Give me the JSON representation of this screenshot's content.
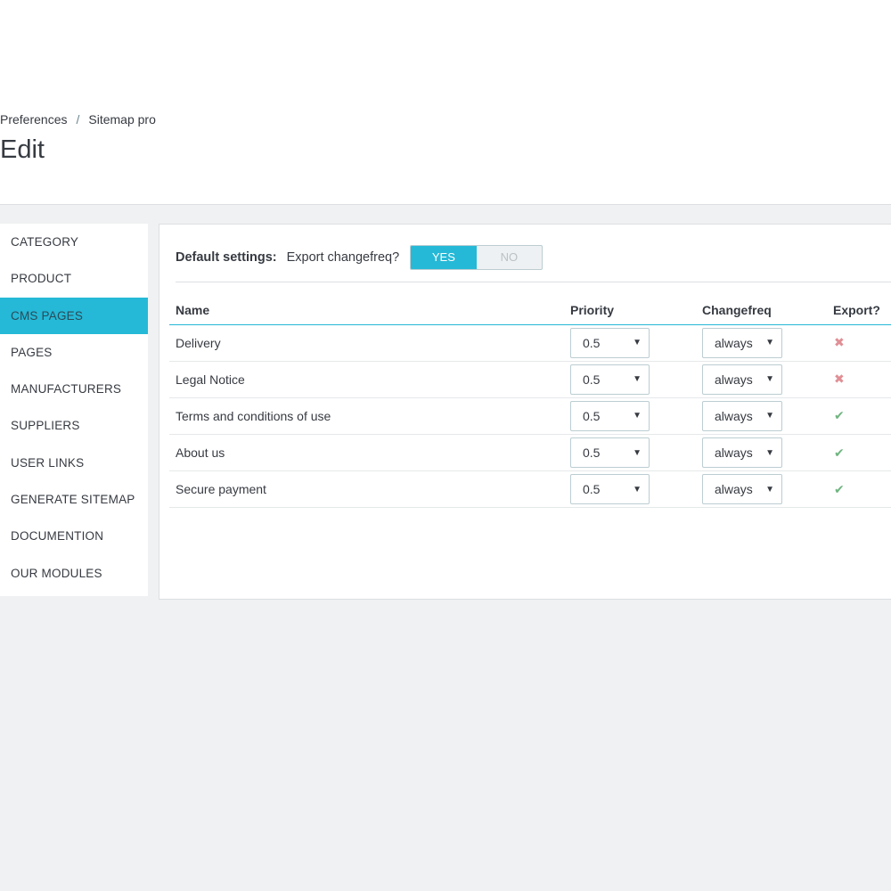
{
  "breadcrumb": {
    "parent": "Preferences",
    "separator": "/",
    "current": "Sitemap pro"
  },
  "page_title": "Edit",
  "sidebar": {
    "items": [
      {
        "label": "CATEGORY"
      },
      {
        "label": "PRODUCT"
      },
      {
        "label": "CMS PAGES",
        "active": true
      },
      {
        "label": "PAGES"
      },
      {
        "label": "MANUFACTURERS"
      },
      {
        "label": "SUPPLIERS"
      },
      {
        "label": "USER LINKS"
      },
      {
        "label": "GENERATE SITEMAP"
      },
      {
        "label": "DOCUMENTION"
      },
      {
        "label": "OUR MODULES"
      }
    ]
  },
  "defaults": {
    "label": "Default settings:",
    "question": "Export changefreq?",
    "yes_label": "YES",
    "no_label": "NO",
    "selected": "YES"
  },
  "table": {
    "headers": {
      "name": "Name",
      "priority": "Priority",
      "changefreq": "Changefreq",
      "export": "Export?"
    },
    "rows": [
      {
        "name": "Delivery",
        "priority": "0.5",
        "changefreq": "always",
        "export": "no"
      },
      {
        "name": "Legal Notice",
        "priority": "0.5",
        "changefreq": "always",
        "export": "no"
      },
      {
        "name": "Terms and conditions of use",
        "priority": "0.5",
        "changefreq": "always",
        "export": "yes"
      },
      {
        "name": "About us",
        "priority": "0.5",
        "changefreq": "always",
        "export": "yes"
      },
      {
        "name": "Secure payment",
        "priority": "0.5",
        "changefreq": "always",
        "export": "yes"
      }
    ]
  },
  "icons": {
    "caret": "caret-down-icon",
    "export_yes": "check-icon",
    "export_no": "cross-icon"
  },
  "colors": {
    "accent": "#25b9d7",
    "check": "#70b580",
    "cross": "#e08f95"
  }
}
